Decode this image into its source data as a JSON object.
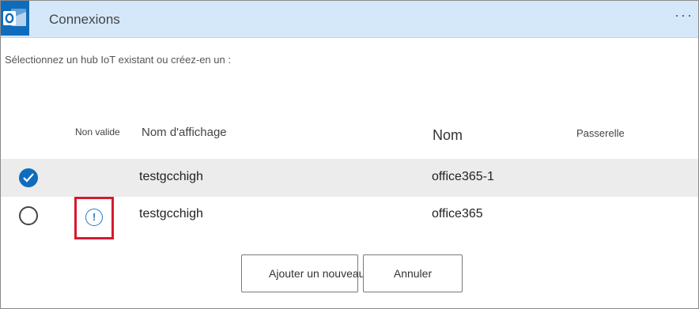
{
  "header": {
    "title": "Connexions",
    "more_label": "···",
    "app_icon": "outlook-icon",
    "accent": "#0f6cbd"
  },
  "instruction": "Sélectionnez un hub IoT existant ou créez-en un :",
  "table": {
    "columns": {
      "invalid": "Non valide",
      "display_name": "Nom d'affichage",
      "name": "Nom",
      "gateway": "Passerelle"
    },
    "rows": [
      {
        "selected": true,
        "invalid": false,
        "display_name": "testgcchigh",
        "name": "office365-1",
        "gateway": ""
      },
      {
        "selected": false,
        "invalid": true,
        "warning_icon": "!",
        "display_name": "testgcchigh",
        "name": "office365",
        "gateway": ""
      }
    ]
  },
  "buttons": {
    "add": "Ajouter un nouveau",
    "cancel": "Annuler"
  },
  "colors": {
    "header_bg": "#d5e8f9",
    "selected_row_bg": "#ececec",
    "highlight_border": "#d7192e",
    "warning_blue": "#1e7ccc"
  }
}
